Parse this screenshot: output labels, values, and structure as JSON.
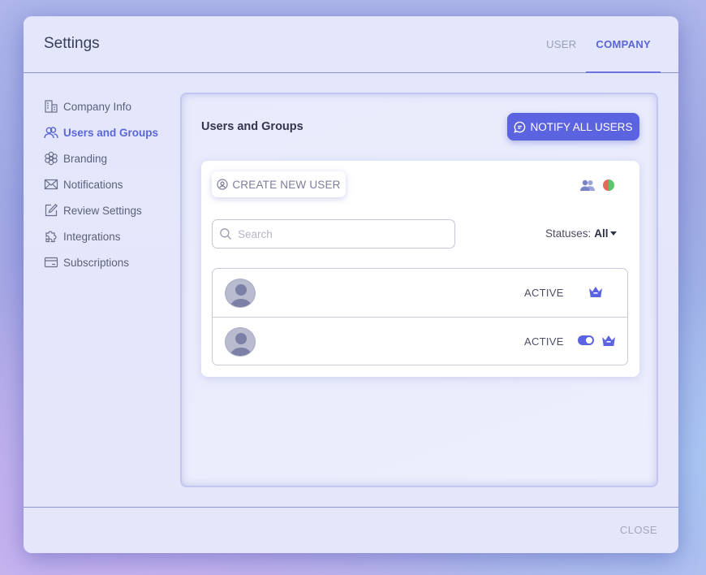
{
  "header": {
    "title": "Settings",
    "tabs": [
      {
        "label": "USER",
        "active": false
      },
      {
        "label": "COMPANY",
        "active": true
      }
    ]
  },
  "sidebar": {
    "items": [
      {
        "label": "Company Info",
        "icon": "building-icon"
      },
      {
        "label": "Users and Groups",
        "icon": "users-icon",
        "active": true
      },
      {
        "label": "Branding",
        "icon": "flower-icon"
      },
      {
        "label": "Notifications",
        "icon": "envelope-icon"
      },
      {
        "label": "Review Settings",
        "icon": "edit-icon"
      },
      {
        "label": "Integrations",
        "icon": "puzzle-icon"
      },
      {
        "label": "Subscriptions",
        "icon": "card-icon"
      }
    ]
  },
  "main": {
    "title": "Users and Groups",
    "notify_label": "NOTIFY ALL USERS",
    "create_label": "CREATE NEW USER",
    "search": {
      "placeholder": "Search",
      "value": ""
    },
    "status_filter": {
      "label": "Statuses:",
      "value": "All"
    },
    "users": [
      {
        "status": "ACTIVE",
        "toggle_on": false,
        "crown": true
      },
      {
        "status": "ACTIVE",
        "toggle_on": true,
        "crown": true
      }
    ]
  },
  "footer": {
    "close_label": "CLOSE"
  },
  "colors": {
    "accent": "#5b63e0",
    "active_text": "#5a64d8",
    "muted_text": "#9a9eb8",
    "pie_green": "#5cc46a",
    "pie_red": "#e46a5a"
  }
}
